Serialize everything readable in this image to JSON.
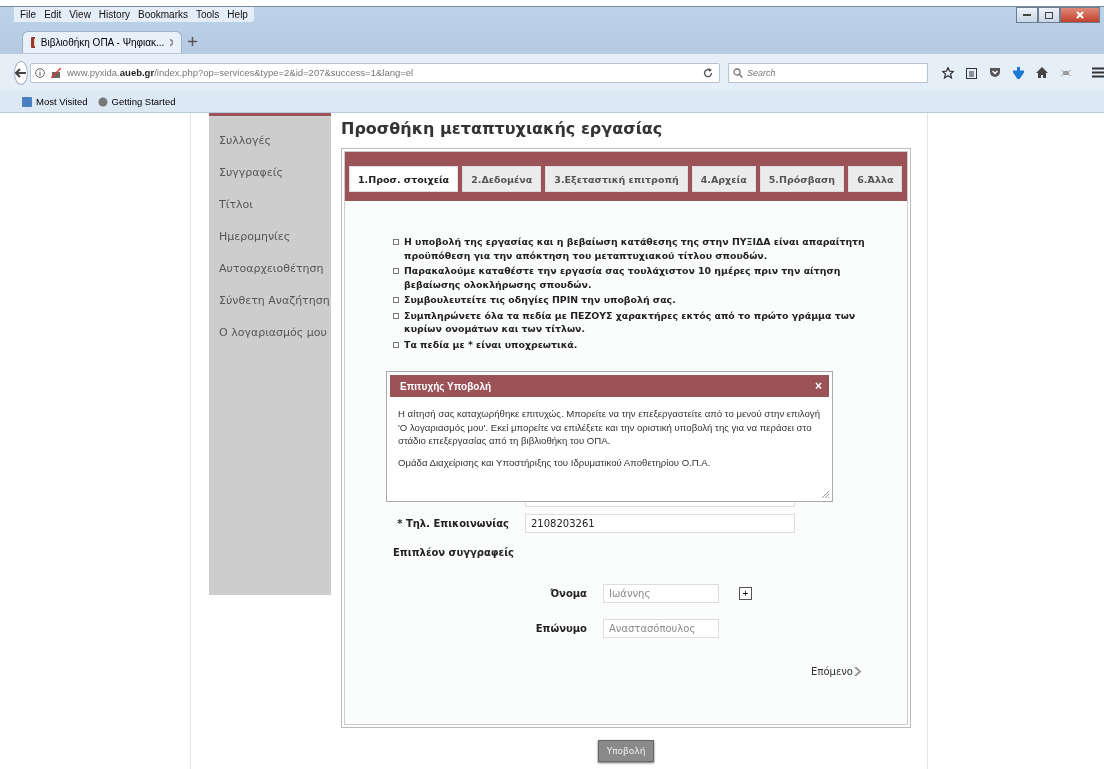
{
  "browser": {
    "menu": [
      "File",
      "Edit",
      "View",
      "History",
      "Bookmarks",
      "Tools",
      "Help"
    ],
    "tabs": [
      {
        "title": "Βιβλιοθήκη ΟΠΑ - Ψηφιακ...",
        "selected": true
      }
    ],
    "url": "www.pyxida.**aueb.gr**/index.php?op=services&type=2&id=207&success=1&lang=el",
    "search": {
      "placeholder": "Search"
    },
    "bookmarks": [
      "Most Visited",
      "Getting Started"
    ]
  },
  "sidebar": {
    "items": [
      "Συλλογές",
      "Συγγραφείς",
      "Τίτλοι",
      "Ημερομηνίες",
      "Αυτοαρχειοθέτηση",
      "Σύνθετη Αναζήτηση",
      "Ο λογαριασμός μου"
    ]
  },
  "page_title": "Προσθήκη μεταπτυχιακής εργασίας",
  "tabs": [
    {
      "label": "1.Προσ. στοιχεία",
      "selected": true
    },
    {
      "label": "2.Δεδομένα",
      "selected": false
    },
    {
      "label": "3.Εξεταστική επιτροπή",
      "selected": false
    },
    {
      "label": "4.Αρχεία",
      "selected": false
    },
    {
      "label": "5.Πρόσβαση",
      "selected": false
    },
    {
      "label": "6.Άλλα",
      "selected": false
    }
  ],
  "notices": [
    "Η υποβολή της εργασίας και η βεβαίωση κατάθεσης της στην ΠΥΞΙΔΑ είναι απαραίτητη προϋπόθεση για την απόκτηση του μεταπτυχιακού τίτλου σπουδών.",
    "Παρακαλούμε καταθέστε την εργασία σας τουλάχιστον 10 ημέρες πριν την αίτηση βεβαίωσης ολοκλήρωσης σπουδών.",
    "Συμβουλευτείτε τις οδηγίες ΠΡΙΝ την υποβολή σας.",
    "Συμπληρώνετε όλα τα πεδία με ΠΕΖΟΥΣ χαρακτήρες εκτός από το πρώτο γράμμα των κυρίων ονομάτων και των τίτλων.",
    "Τα πεδία με * είναι υποχρεωτικά."
  ],
  "dialog": {
    "title": "Επιτυχής Υποβολή",
    "close": "×",
    "paragraphs": [
      "Η αίτησή σας καταχωρήθηκε επιτυχώς. Μπορείτε να την επεξεργαστείτε από το μενού στην επιλογή 'Ο λογαριασμός μου'. Εκεί μπορείτε να επιλέξετε και την οριστική υποβολή της για να περάσει στο στάδιο επεξεργασίας από τη βιβλιοθήκη του ΟΠΑ.",
      "Ομάδα Διαχείρισης και Υποστήριξης του Ιδρυματικού Αποθετηρίου Ο.Π.Α."
    ]
  },
  "phone": {
    "label": "* Τηλ. Επικοινωνίας",
    "value": "2108203261"
  },
  "extra_authors": {
    "heading": "Επιπλέον συγγραφείς",
    "first_name": {
      "label": "Όνομα",
      "placeholder": "Ιωάννης",
      "add": "+"
    },
    "last_name": {
      "label": "Επώνυμο",
      "placeholder": "Αναστασόπουλος"
    }
  },
  "next": "Επόμενο",
  "submit": "Υποβολή"
}
